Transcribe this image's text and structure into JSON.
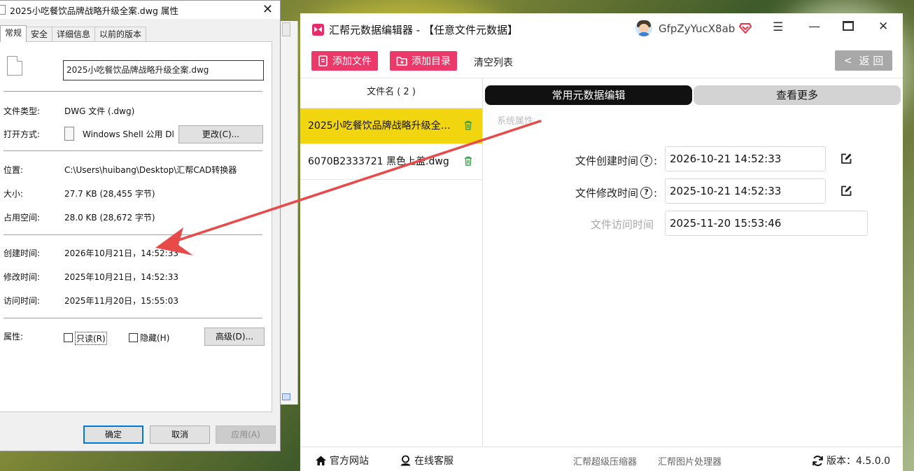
{
  "dialog": {
    "title": "2025小吃餐饮品牌战略升级全案.dwg 属性",
    "tabs": [
      "常规",
      "安全",
      "详细信息",
      "以前的版本"
    ],
    "file_name": "2025小吃餐饮品牌战略升级全案.dwg",
    "file_type_label": "文件类型:",
    "file_type_value": "DWG 文件 (.dwg)",
    "open_with_label": "打开方式:",
    "open_with_value": "Windows Shell 公用 Dl",
    "change_button": "更改(C)...",
    "location_label": "位置:",
    "location_value": "C:\\Users\\huibang\\Desktop\\汇帮CAD转换器",
    "size_label": "大小:",
    "size_value": "27.7 KB (28,455 字节)",
    "disk_size_label": "占用空间:",
    "disk_size_value": "28.0 KB (28,672 字节)",
    "created_label": "创建时间:",
    "created_value": "2026年10月21日，14:52:33",
    "modified_label": "修改时间:",
    "modified_value": "2025年10月21日，14:52:33",
    "accessed_label": "访问时间:",
    "accessed_value": "2025年11月20日，15:55:03",
    "attributes_label": "属性:",
    "readonly_label": "只读(R)",
    "hidden_label": "隐藏(H)",
    "advanced_button": "高级(D)...",
    "ok_button": "确定",
    "cancel_button": "取消",
    "apply_button": "应用(A)"
  },
  "app": {
    "title": "汇帮元数据编辑器 - 【任意文件元数据】",
    "username": "GfpZyYucX8ab",
    "toolbar": {
      "add_file": "添加文件",
      "add_folder": "添加目录",
      "clear_list": "清空列表",
      "back": "返 回"
    },
    "file_list": {
      "header": "文件名 ( 2 )",
      "items": [
        "2025小吃餐饮品牌战略升级全案.dwg",
        "6070B2333721 黑色上盖.dwg"
      ]
    },
    "editor": {
      "tab_active": "常用元数据编辑",
      "tab_more": "查看更多",
      "section_label": "系统属性",
      "created_label": "文件创建时间",
      "created_value": "2026-10-21 14:52:33",
      "modified_label": "文件修改时间",
      "modified_value": "2025-10-21 14:52:33",
      "accessed_label": "文件访问时间",
      "accessed_value": "2025-11-20 15:53:46",
      "colon": ":"
    },
    "footer": {
      "website": "官方网站",
      "support": "在线客服",
      "compressor": "汇帮超级压缩器",
      "image_tool": "汇帮图片处理器",
      "version": "版本：4.5.0.0"
    },
    "colors": {
      "accent_pink": "#eb3a6a",
      "selected_yellow": "#f1d50f",
      "annotation_red": "#e84a4a"
    }
  }
}
